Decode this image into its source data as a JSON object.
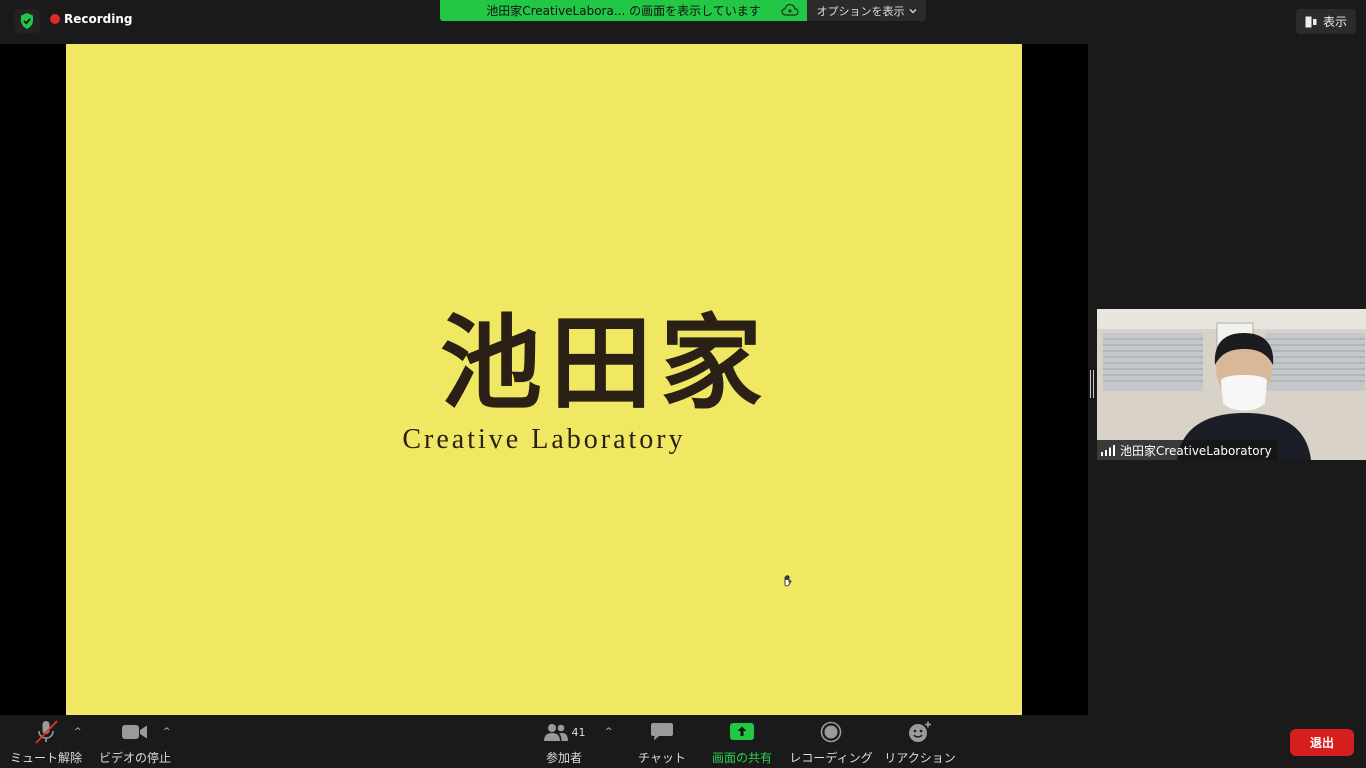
{
  "top_bar": {
    "recording_label": "Recording",
    "share_banner_text": "池田家CreativeLabora... の画面を表示しています",
    "options_label": "オプションを表示",
    "view_label": "表示"
  },
  "slide": {
    "logo_kanji": "池田家",
    "logo_subtitle": "Creative Laboratory",
    "background_color": "#f0e862"
  },
  "participant_video": {
    "name": "池田家CreativeLaboratory"
  },
  "toolbar": {
    "mute_label": "ミュート解除",
    "video_label": "ビデオの停止",
    "participants_label": "参加者",
    "participants_count": "41",
    "chat_label": "チャット",
    "share_label": "画面の共有",
    "record_label": "レコーディング",
    "reaction_label": "リアクション",
    "leave_label": "退出"
  },
  "colors": {
    "accent_green": "#22c746",
    "leave_red": "#d61e1e",
    "recording_red": "#e02828"
  },
  "icons": [
    "shield-check-icon",
    "record-dot-icon",
    "cloud-icon",
    "chevron-down-icon",
    "view-layout-icon",
    "hand-cursor-icon",
    "signal-bars-icon",
    "muted-mic-icon",
    "video-camera-icon",
    "participants-icon",
    "chat-bubble-icon",
    "share-screen-icon",
    "record-icon",
    "reaction-icon"
  ]
}
